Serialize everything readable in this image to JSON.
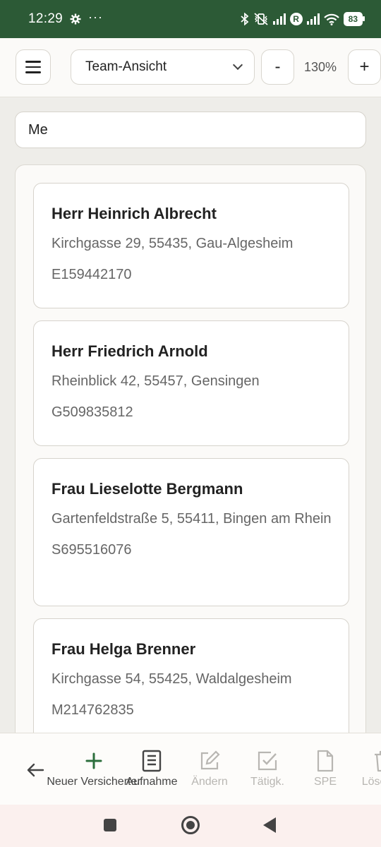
{
  "status_bar": {
    "time": "12:29",
    "battery": "83",
    "roaming_badge": "R",
    "icons": [
      "gear-icon",
      "more-dots-icon",
      "bluetooth-icon",
      "muted-vibrate-icon",
      "signal-icon",
      "wifi-icon",
      "battery-icon"
    ]
  },
  "toolbar": {
    "view_select_value": "Team-Ansicht",
    "zoom_minus": "-",
    "zoom_level": "130%",
    "zoom_plus": "+"
  },
  "search": {
    "value": "Me"
  },
  "customers": [
    {
      "name": "Herr Heinrich Albrecht",
      "address": "Kirchgasse 29, 55435, Gau-Algesheim",
      "id": "E159442170"
    },
    {
      "name": "Herr Friedrich Arnold",
      "address": "Rheinblick 42, 55457, Gensingen",
      "id": "G509835812"
    },
    {
      "name": "Frau Lieselotte Bergmann",
      "address": "Gartenfeldstraße 5, 55411, Bingen am Rhein",
      "id": "S695516076"
    },
    {
      "name": "Frau Helga Brenner",
      "address": "Kirchgasse 54, 55425, Waldalgesheim",
      "id": "M214762835"
    }
  ],
  "action_bar": {
    "items": [
      {
        "label": "Neuer Versicherter",
        "icon": "plus-icon",
        "enabled": true
      },
      {
        "label": "Aufnahme",
        "icon": "document-icon",
        "enabled": true
      },
      {
        "label": "Ändern",
        "icon": "edit-icon",
        "enabled": false
      },
      {
        "label": "Tätigk.",
        "icon": "checkbox-icon",
        "enabled": false
      },
      {
        "label": "SPE",
        "icon": "file-icon",
        "enabled": false
      },
      {
        "label": "Löschen",
        "icon": "trash-icon",
        "enabled": false
      }
    ]
  },
  "colors": {
    "status_bar": "#2c5a36",
    "accent_green": "#2c6e3c",
    "disabled": "#b8b6b2"
  }
}
